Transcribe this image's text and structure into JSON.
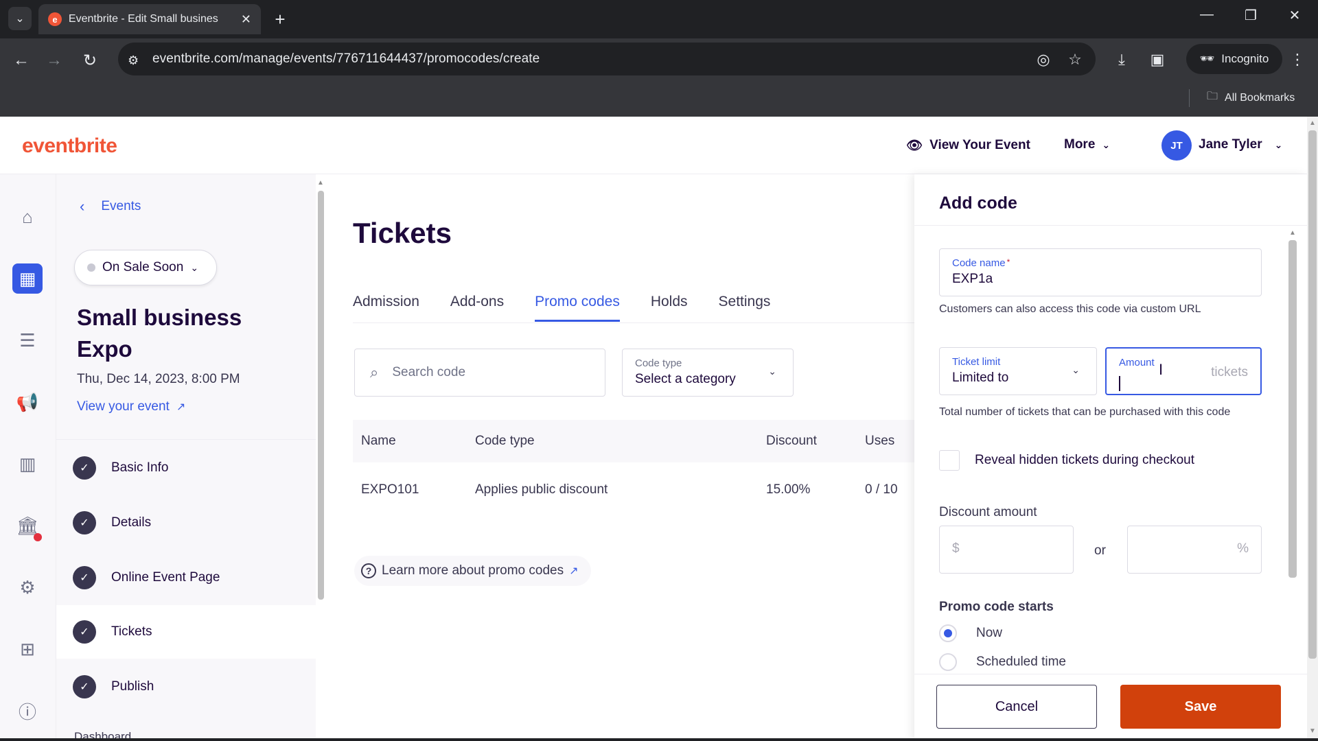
{
  "browser": {
    "tab_title": "Eventbrite - Edit Small busines",
    "url": "eventbrite.com/manage/events/776711644437/promocodes/create",
    "incognito_label": "Incognito",
    "bookmarks_label": "All Bookmarks"
  },
  "header": {
    "logo": "eventbrite",
    "view_event": "View Your Event",
    "more": "More",
    "user_initials": "JT",
    "user_name": "Jane Tyler"
  },
  "sidebar": {
    "back_label": "Events",
    "status": "On Sale Soon",
    "event_title": "Small business Expo",
    "event_date": "Thu, Dec 14, 2023, 8:00 PM",
    "view_event_link": "View your event",
    "steps": [
      {
        "label": "Basic Info"
      },
      {
        "label": "Details"
      },
      {
        "label": "Online Event Page"
      },
      {
        "label": "Tickets"
      },
      {
        "label": "Publish"
      }
    ],
    "dashboard_peek": "Dashboard"
  },
  "main": {
    "title": "Tickets",
    "tabs": [
      {
        "label": "Admission"
      },
      {
        "label": "Add-ons"
      },
      {
        "label": "Promo codes"
      },
      {
        "label": "Holds"
      },
      {
        "label": "Settings"
      }
    ],
    "search_placeholder": "Search code",
    "code_type": {
      "label": "Code type",
      "value": "Select a category"
    },
    "table": {
      "headers": [
        "Name",
        "Code type",
        "Discount",
        "Uses"
      ],
      "rows": [
        {
          "name": "EXPO101",
          "code_type": "Applies public discount",
          "discount": "15.00%",
          "uses": "0 / 10"
        }
      ]
    },
    "learn_more": "Learn more about promo codes"
  },
  "drawer": {
    "title": "Add code",
    "code_name": {
      "label": "Code name",
      "required_mark": "*",
      "value": "EXP1a"
    },
    "code_name_help": "Customers can also access this code via custom URL",
    "ticket_limit": {
      "label": "Ticket limit",
      "value": "Limited to"
    },
    "amount": {
      "label": "Amount",
      "unit": "tickets",
      "value": ""
    },
    "limit_help": "Total number of tickets that can be purchased with this code",
    "reveal_label": "Reveal hidden tickets during checkout",
    "discount_label": "Discount amount",
    "dollar_prefix": "$",
    "or_label": "or",
    "percent_suffix": "%",
    "starts_label": "Promo code starts",
    "starts_options": [
      {
        "label": "Now",
        "selected": true
      },
      {
        "label": "Scheduled time",
        "selected": false
      }
    ],
    "cancel": "Cancel",
    "save": "Save"
  },
  "colors": {
    "brand": "#f05537",
    "accent": "#3659e3",
    "save": "#d1410c",
    "text": "#1e0a3c"
  }
}
